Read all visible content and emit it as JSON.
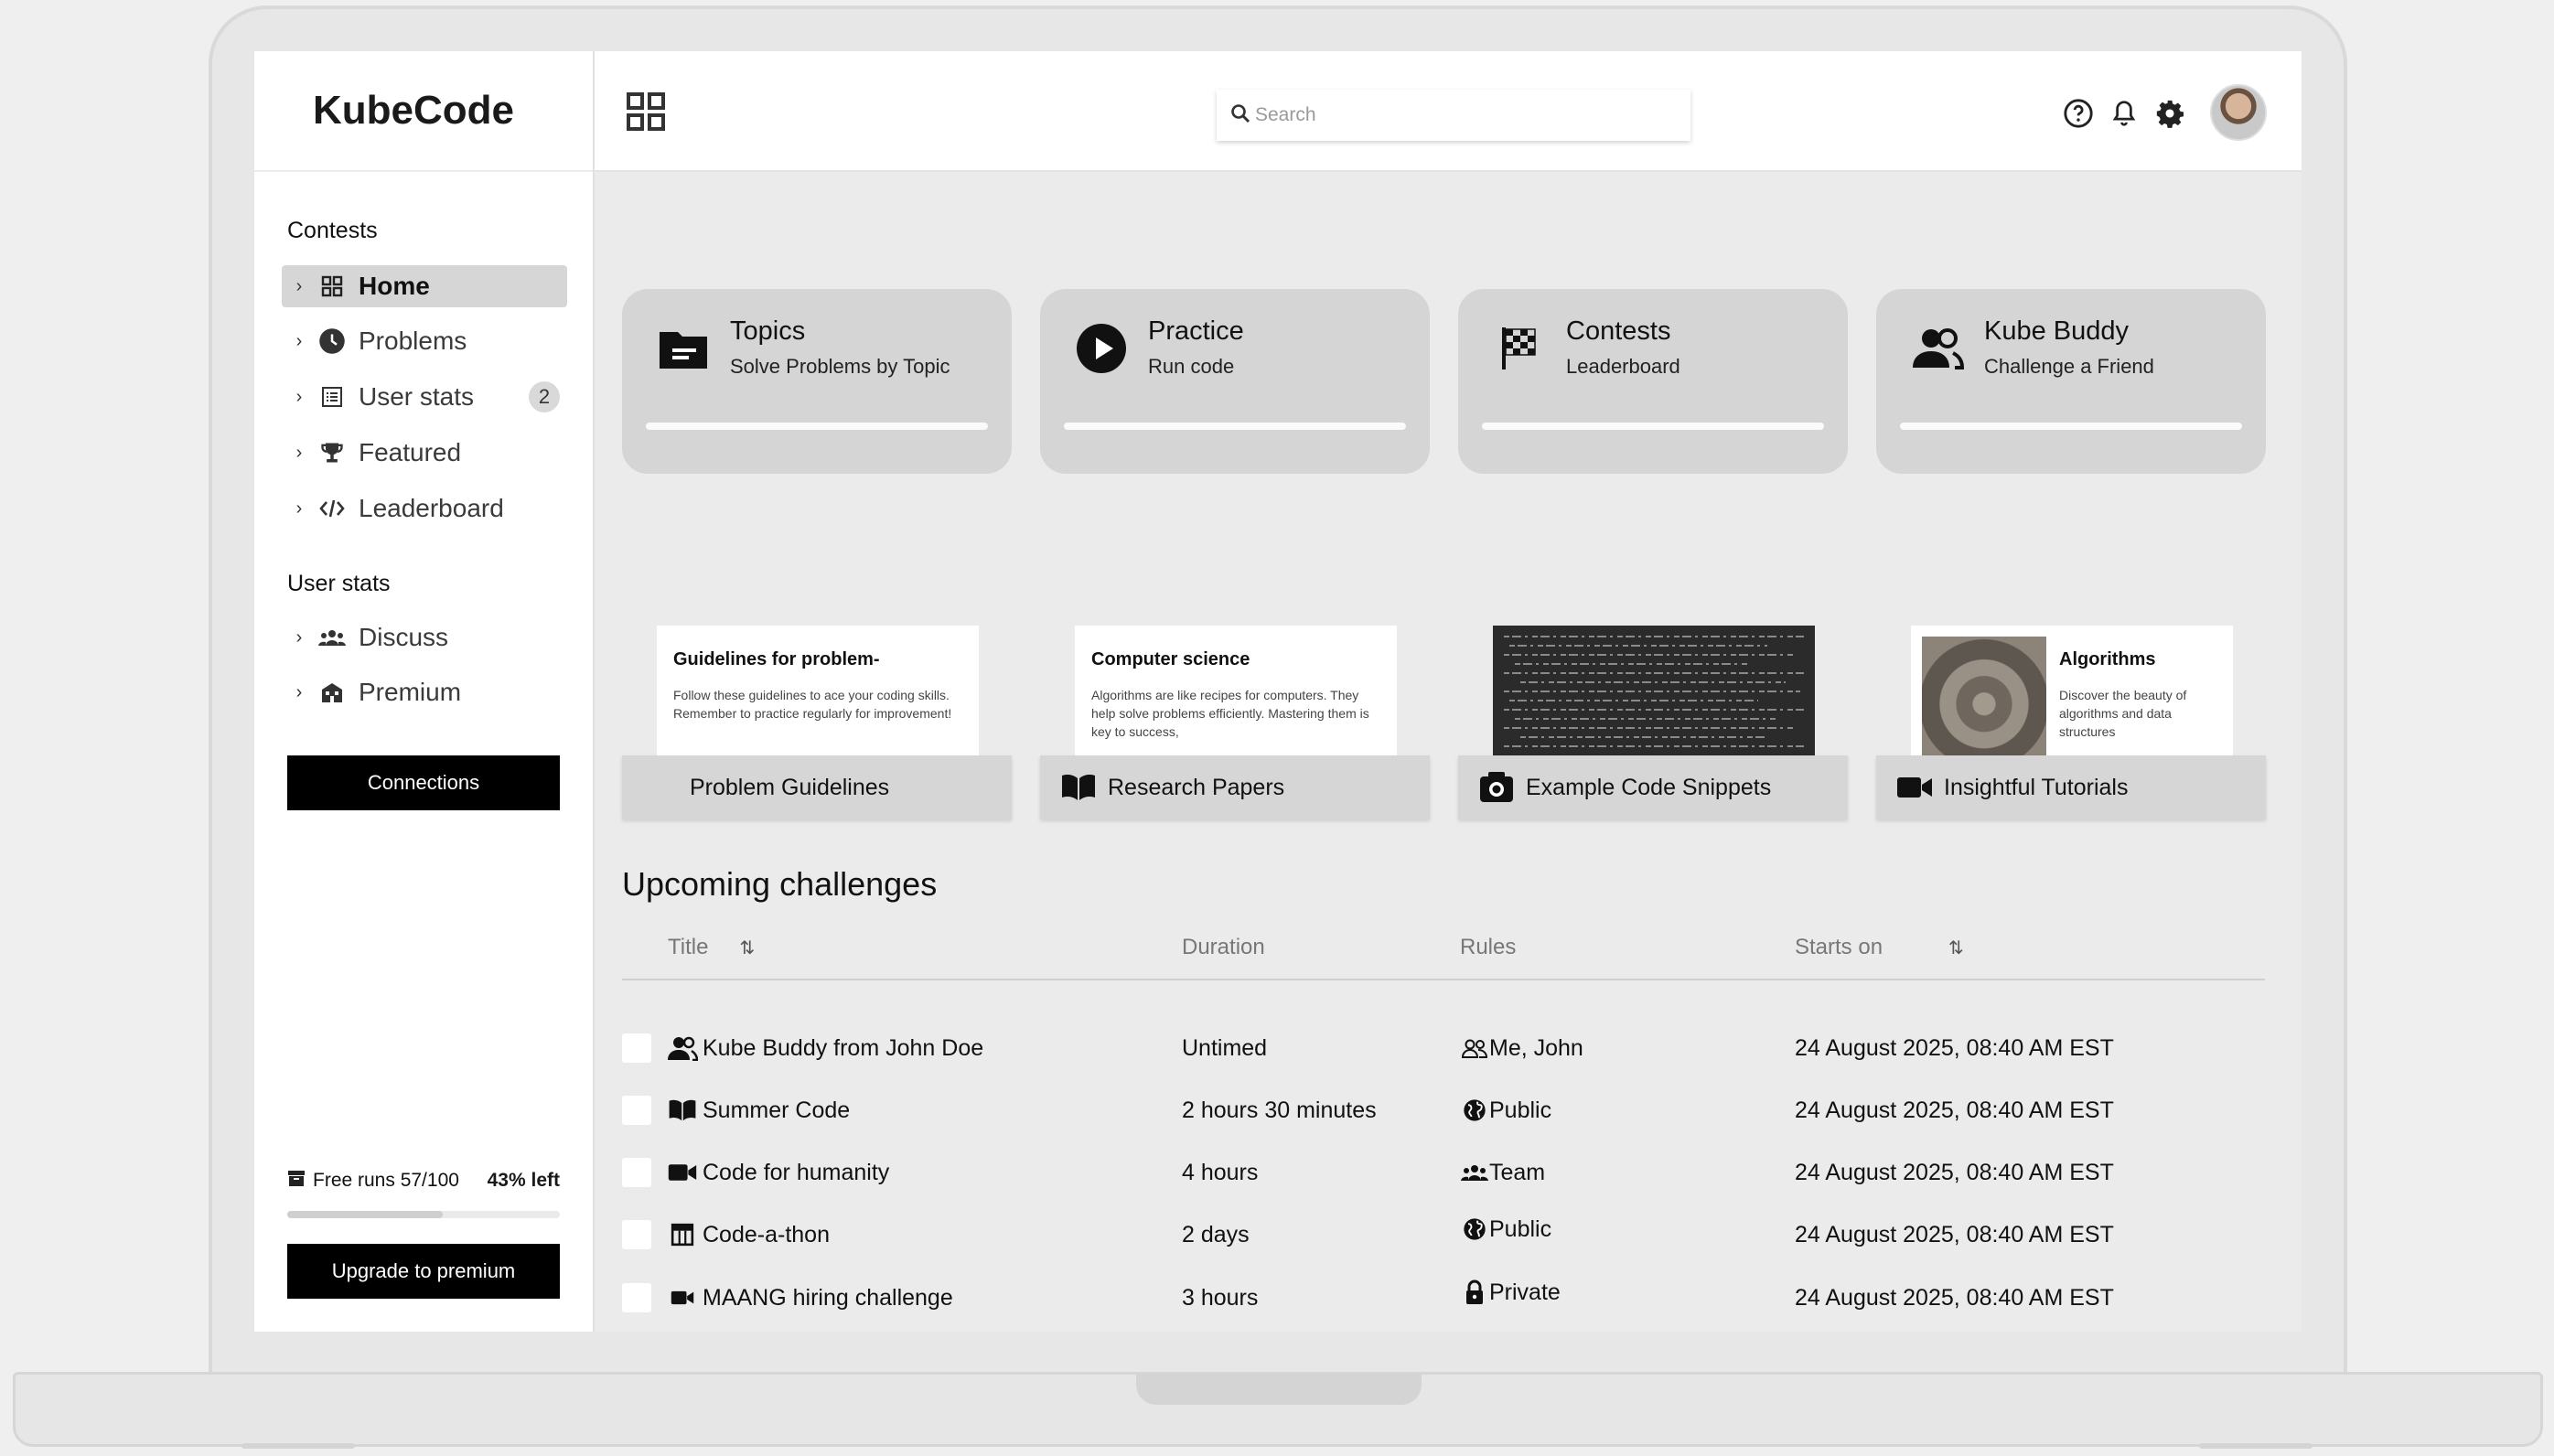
{
  "app": {
    "name": "KubeCode"
  },
  "search": {
    "placeholder": "Search"
  },
  "sidebar": {
    "sections": [
      {
        "title": "Contests"
      },
      {
        "title": "User stats"
      }
    ],
    "items": [
      {
        "label": "Home",
        "icon": "grid-icon",
        "active": true
      },
      {
        "label": "Problems",
        "icon": "clock-icon"
      },
      {
        "label": "User stats",
        "icon": "list-icon",
        "badge": "2"
      },
      {
        "label": "Featured",
        "icon": "trophy-icon"
      },
      {
        "label": "Leaderboard",
        "icon": "code-icon"
      },
      {
        "label": "Discuss",
        "icon": "group-icon"
      },
      {
        "label": "Premium",
        "icon": "building-icon"
      }
    ],
    "connections_label": "Connections",
    "free_runs_label": "Free runs 57/100",
    "left_label": "43% left",
    "runs_progress": 0.57,
    "upgrade_label": "Upgrade to premium"
  },
  "feature_cards": [
    {
      "title": "Topics",
      "subtitle": "Solve Problems by Topic",
      "icon": "folder-icon"
    },
    {
      "title": "Practice",
      "subtitle": "Run code",
      "icon": "play-icon"
    },
    {
      "title": "Contests",
      "subtitle": "Leaderboard",
      "icon": "checkered-flag-icon"
    },
    {
      "title": "Kube Buddy",
      "subtitle": "Challenge a Friend",
      "icon": "people-icon"
    }
  ],
  "resource_cards": [
    {
      "label": "Problem Guidelines",
      "thumb_title": "Guidelines for problem-",
      "thumb_text": "Follow these guidelines to ace your coding skills. Remember to practice regularly for improvement!"
    },
    {
      "label": "Research Papers",
      "icon": "book-icon",
      "thumb_title": "Computer science",
      "thumb_text": "Algorithms are like recipes for computers. They help solve problems efficiently. Mastering them is key to success,"
    },
    {
      "label": "Example Code Snippets",
      "icon": "camera-icon"
    },
    {
      "label": "Insightful Tutorials",
      "icon": "video-icon",
      "thumb_title": "Algorithms",
      "thumb_text": "Discover the beauty of algorithms and data structures"
    }
  ],
  "challenges": {
    "heading": "Upcoming challenges",
    "columns": {
      "title": "Title",
      "duration": "Duration",
      "rules": "Rules",
      "starts_on": "Starts on"
    },
    "rows": [
      {
        "title": "Kube Buddy from John Doe",
        "title_icon": "people-icon",
        "duration": "Untimed",
        "rules": "Me, John",
        "rules_icon": "people-outline-icon",
        "starts_on": "24 August 2025, 08:40 AM EST"
      },
      {
        "title": "Summer Code",
        "title_icon": "book-icon",
        "duration": "2 hours 30 minutes",
        "rules": "Public",
        "rules_icon": "globe-icon",
        "starts_on": "24 August 2025, 08:40 AM EST"
      },
      {
        "title": "Code for humanity",
        "title_icon": "video-icon",
        "duration": "4 hours",
        "rules": "Team",
        "rules_icon": "group-icon",
        "starts_on": "24 August 2025, 08:40 AM EST"
      },
      {
        "title": "Code-a-thon",
        "title_icon": "calendar-table-icon",
        "duration": "2 days",
        "rules": "Public",
        "rules_icon": "globe-icon",
        "starts_on": "24 August 2025, 08:40 AM EST"
      },
      {
        "title": "MAANG hiring challenge",
        "title_icon": "video-small-icon",
        "duration": "3 hours",
        "rules": "Private",
        "rules_icon": "lock-icon",
        "starts_on": "24 August 2025, 08:40 AM EST"
      }
    ]
  }
}
